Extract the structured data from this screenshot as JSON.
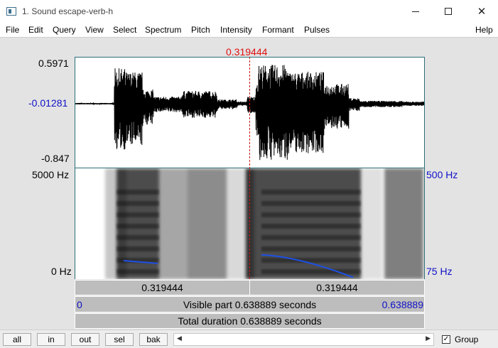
{
  "window": {
    "title": "1. Sound escape-verb-h",
    "icon": "praat-window-icon"
  },
  "menu": [
    "File",
    "Edit",
    "Query",
    "View",
    "Select",
    "Spectrum",
    "Pitch",
    "Intensity",
    "Formant",
    "Pulses",
    "Help"
  ],
  "waveform": {
    "cursor_time": "0.319444",
    "y_max": "0.5971",
    "y_zero": "-0.01281",
    "y_min": "-0.847"
  },
  "spectrogram": {
    "freq_top": "5000 Hz",
    "freq_bottom": "0 Hz",
    "pitch_top": "500 Hz",
    "pitch_bottom": "75 Hz"
  },
  "selection_bar": {
    "left_value": "0.319444",
    "right_value": "0.319444"
  },
  "visible_bar": {
    "start": "0",
    "label": "Visible part 0.638889 seconds",
    "end": "0.638889"
  },
  "total_bar": {
    "label": "Total duration 0.638889 seconds"
  },
  "buttons": {
    "all": "all",
    "in": "in",
    "out": "out",
    "sel": "sel",
    "bak": "bak"
  },
  "group": {
    "label": "Group",
    "checked": true
  },
  "colors": {
    "cursor": "#e01010",
    "axis_blue": "#1010c8",
    "pitch_curve": "#1e50e6",
    "frame": "#2c6f78"
  }
}
